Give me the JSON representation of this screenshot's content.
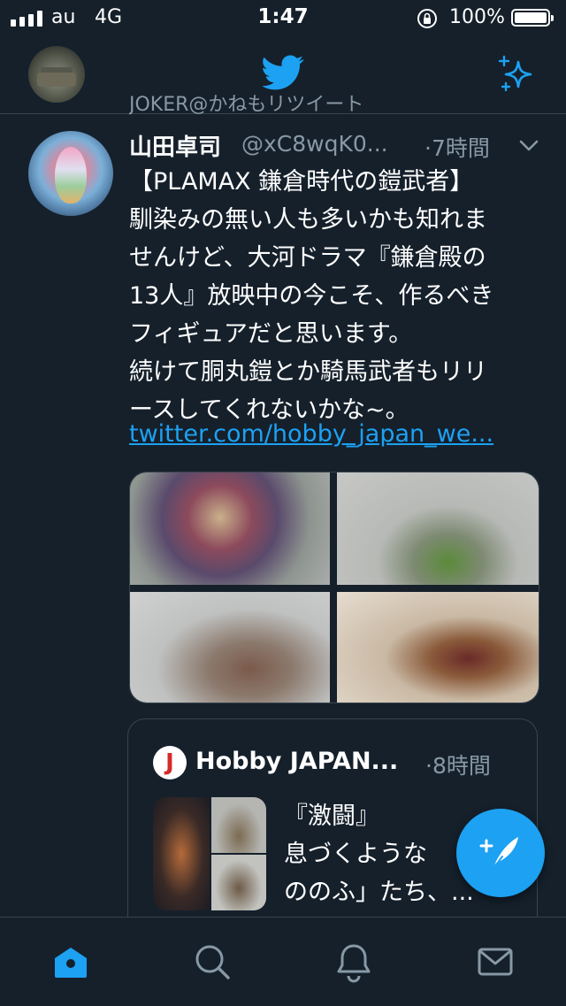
{
  "status_bar": {
    "carrier": "au",
    "network": "4G",
    "time": "1:47",
    "battery_percent": "100%",
    "icons": [
      "signal-icon",
      "orientation-lock-icon",
      "battery-icon"
    ]
  },
  "header": {
    "logo_icon": "twitter-bird-icon",
    "sparkle_icon": "sparkle-icon"
  },
  "timeline": {
    "retweet_context": "JOKER@かねもリツイート",
    "tweet": {
      "display_name": "山田卓司",
      "handle": "@xC8wqK0...",
      "time": "·7時間",
      "text": "【PLAMAX 鎌倉時代の鎧武者】\n馴染みの無い人も多いかも知れま\nせんけど、大河ドラマ『鎌倉殿の\n13人』放映中の今こそ、作るべき\nフィギュアだと思います。\n続けて胴丸鎧とか騎馬武者もリリ\nースしてくれないかな~。",
      "link": "twitter.com/hobby_japan_we..."
    },
    "quoted_tweet": {
      "display_name": "Hobby JAPAN...",
      "time": "·8時間",
      "text": "『激闘』\n息づくような\nののふ」たち、..."
    }
  },
  "tab_bar": {
    "tabs": [
      "home-icon",
      "search-icon",
      "notifications-icon",
      "messages-icon"
    ],
    "active": "home-icon"
  },
  "colors": {
    "background": "#15202b",
    "accent": "#1da1f2",
    "secondary_text": "#8899a6",
    "divider": "#38444d"
  }
}
